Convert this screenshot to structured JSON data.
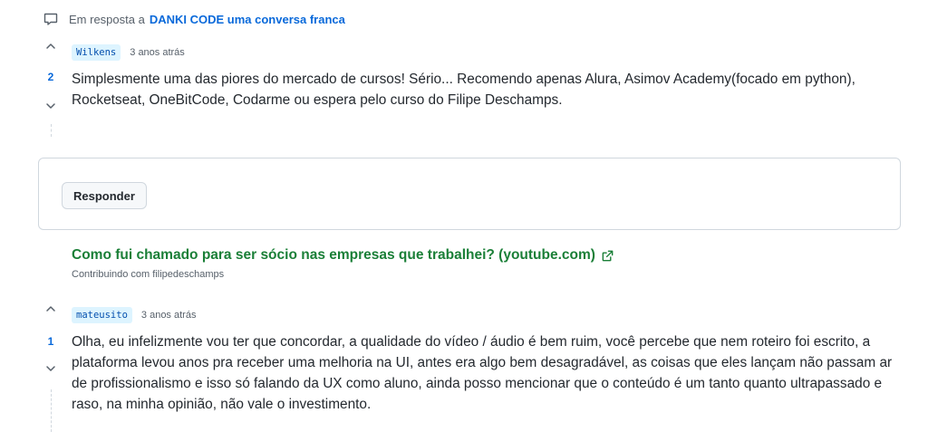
{
  "reply_header": {
    "prefix": "Em resposta a",
    "link": "DANKI CODE uma conversa franca"
  },
  "comments": [
    {
      "username": "Wilkens",
      "time": "3 anos atrás",
      "score": "2",
      "body": "Simplesmente uma das piores do mercado de cursos! Sério... Recomendo apenas Alura, Asimov Academy(focado em python), Rocketseat, OneBitCode, Codarme ou espera pelo curso do Filipe Deschamps."
    },
    {
      "username": "mateusito",
      "time": "3 anos atrás",
      "score": "1",
      "body": "Olha, eu infelizmente vou ter que concordar, a qualidade do vídeo / áudio é bem ruim, você percebe que nem roteiro foi escrito, a plataforma levou anos pra receber uma melhoria na UI, antes era algo bem desagradável, as coisas que eles lançam não passam ar de profissionalismo e isso só falando da UX como aluno, ainda posso mencionar que o conteúdo é um tanto quanto ultrapassado e raso, na minha opinião, não vale o investimento."
    }
  ],
  "reply_button": "Responder",
  "article": {
    "title": "Como fui chamado para ser sócio nas empresas que trabalhei? (youtube.com)",
    "subtitle": "Contribuindo com filipedeschamps"
  },
  "colors": {
    "accent": "#0969da",
    "link_green": "#1a7f37",
    "username_bg": "#ddf4ff",
    "border": "#d0d7de"
  },
  "icons": {
    "reply": "comment-icon",
    "upvote": "chevron-up-icon",
    "downvote": "chevron-down-icon",
    "external": "external-link-icon"
  }
}
